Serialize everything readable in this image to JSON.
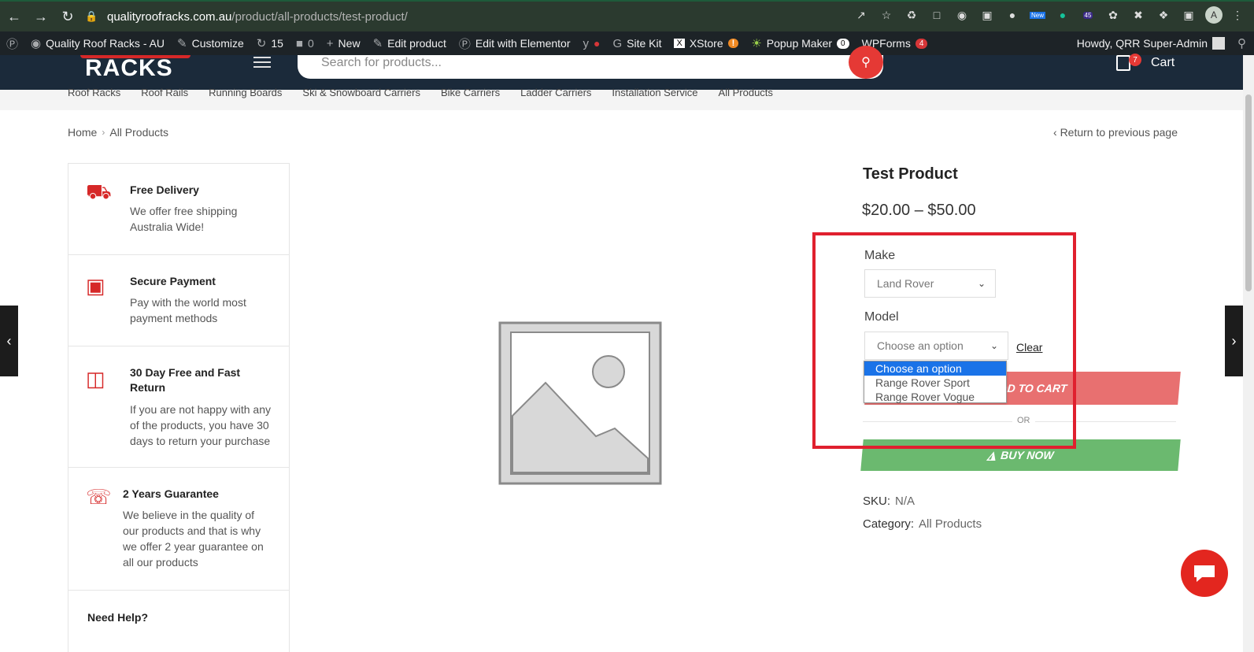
{
  "browser": {
    "url_host": "qualityroofracks.com.au",
    "url_path": "/product/all-products/test-product/",
    "profile_initial": "A",
    "ext_badge_count": "45",
    "ext_new_label": "New"
  },
  "admin_bar": {
    "site_name": "Quality Roof Racks - AU",
    "customize": "Customize",
    "updates_count": "15",
    "comments_count": "0",
    "new": "New",
    "edit_product": "Edit product",
    "edit_elementor": "Edit with Elementor",
    "site_kit": "Site Kit",
    "xstore": "XStore",
    "xstore_badge": "!",
    "popup_maker": "Popup Maker",
    "popup_count": "0",
    "wpforms": "WPForms",
    "wpforms_count": "4",
    "howdy": "Howdy, QRR Super-Admin"
  },
  "header": {
    "logo_text": "RACKS",
    "search_placeholder": "Search for products...",
    "cart_count": "7",
    "cart_label": "Cart"
  },
  "categories": [
    "Roof Racks",
    "Roof Rails",
    "Running Boards",
    "Ski & Snowboard Carriers",
    "Bike Carriers",
    "Ladder Carriers",
    "Installation Service",
    "All Products"
  ],
  "breadcrumb": {
    "home": "Home",
    "current": "All Products",
    "return": "Return to previous page"
  },
  "benefits": [
    {
      "title": "Free Delivery",
      "desc": "We offer free shipping Australia Wide!"
    },
    {
      "title": "Secure Payment",
      "desc": "Pay with the world most payment methods"
    },
    {
      "title": "30 Day Free and Fast Return",
      "desc": "If you are not happy with any of the products, you have 30 days to return your purchase"
    },
    {
      "title": "2 Years Guarantee",
      "desc": "We believe in the quality of our products and that is why we offer 2 year guarantee on all our products"
    }
  ],
  "need_help": "Need Help?",
  "product": {
    "title": "Test Product",
    "price": "$20.00 – $50.00",
    "make_label": "Make",
    "make_value": "Land Rover",
    "model_label": "Model",
    "model_value": "Choose an option",
    "clear": "Clear",
    "model_options": [
      "Choose an option",
      "Range Rover Sport",
      "Range Rover Vogue"
    ],
    "add_to_cart": "ADD TO CART",
    "or": "OR",
    "buy_now": "BUY NOW",
    "sku_label": "SKU:",
    "sku_value": "N/A",
    "category_label": "Category:",
    "category_value": "All Products"
  },
  "colors": {
    "accent_red": "#e53935",
    "highlight_red": "#e0202e",
    "add_to_cart_bg": "#e87070",
    "buy_now_bg": "#6bb96f",
    "header_bg": "#1b2a3a"
  }
}
